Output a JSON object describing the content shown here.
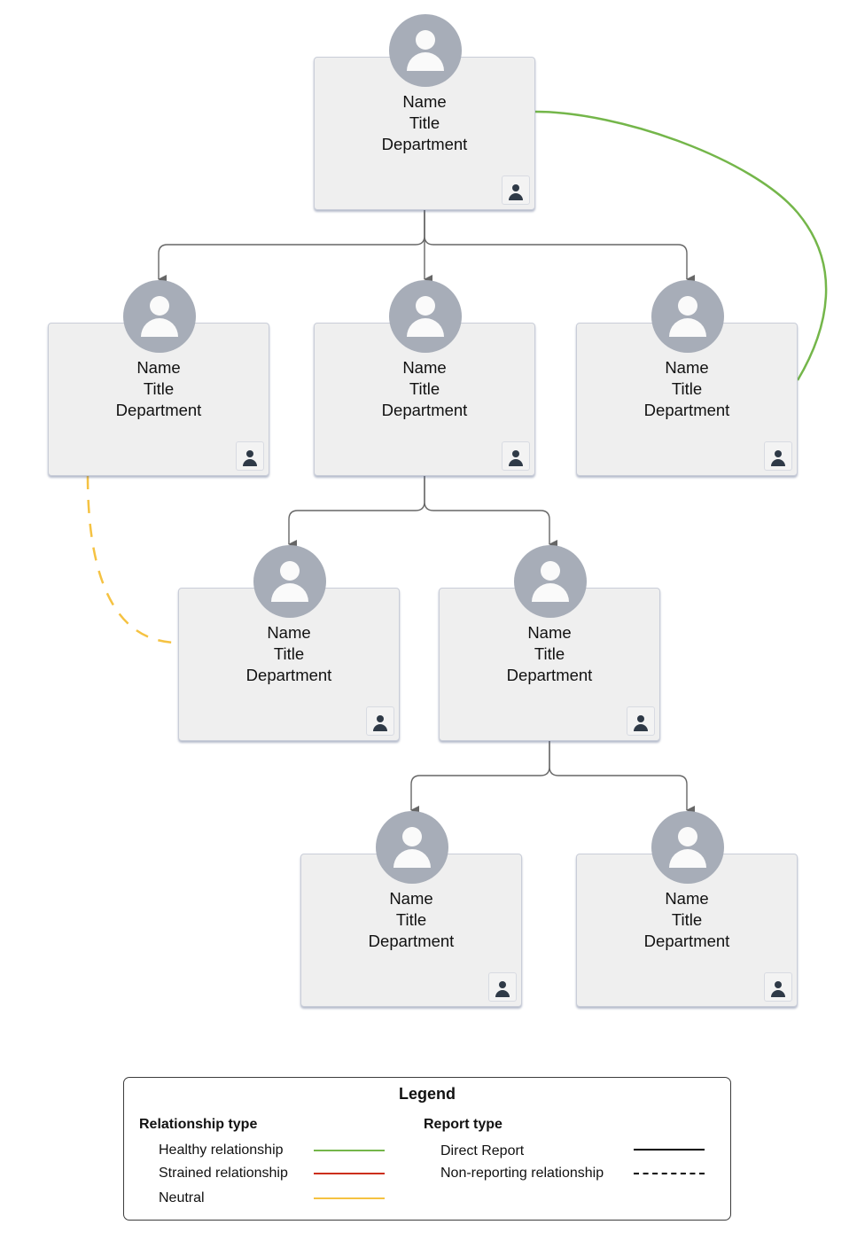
{
  "diagram": {
    "type": "org-chart",
    "nodes": [
      {
        "id": "n0",
        "name": "Name",
        "title": "Title",
        "department": "Department"
      },
      {
        "id": "n1",
        "name": "Name",
        "title": "Title",
        "department": "Department"
      },
      {
        "id": "n2",
        "name": "Name",
        "title": "Title",
        "department": "Department"
      },
      {
        "id": "n3",
        "name": "Name",
        "title": "Title",
        "department": "Department"
      },
      {
        "id": "n4",
        "name": "Name",
        "title": "Title",
        "department": "Department"
      },
      {
        "id": "n5",
        "name": "Name",
        "title": "Title",
        "department": "Department"
      },
      {
        "id": "n6",
        "name": "Name",
        "title": "Title",
        "department": "Department"
      },
      {
        "id": "n7",
        "name": "Name",
        "title": "Title",
        "department": "Department"
      }
    ],
    "edges": [
      {
        "from": "n0",
        "to": "n1",
        "report": "direct"
      },
      {
        "from": "n0",
        "to": "n2",
        "report": "direct"
      },
      {
        "from": "n0",
        "to": "n3",
        "report": "direct"
      },
      {
        "from": "n2",
        "to": "n4",
        "report": "direct"
      },
      {
        "from": "n2",
        "to": "n5",
        "report": "direct"
      },
      {
        "from": "n5",
        "to": "n6",
        "report": "direct"
      },
      {
        "from": "n5",
        "to": "n7",
        "report": "direct"
      },
      {
        "from": "n0",
        "to": "n3",
        "report": "non-reporting",
        "relationship": "healthy"
      },
      {
        "from": "n1",
        "to": "n4",
        "report": "non-reporting",
        "relationship": "neutral"
      }
    ]
  },
  "colors": {
    "direct_report": "#666666",
    "healthy": "#74b64a",
    "strained": "#cc2e13",
    "neutral": "#f5c242",
    "legend_direct": "#000000"
  },
  "legend": {
    "title": "Legend",
    "relationship_heading": "Relationship type",
    "relationship_items": [
      {
        "label": "Healthy relationship",
        "color": "#74b64a"
      },
      {
        "label": "Strained relationship",
        "color": "#cc2e13"
      },
      {
        "label": "Neutral",
        "color": "#f5c242"
      }
    ],
    "report_heading": "Report type",
    "report_items": [
      {
        "label": "Direct Report",
        "style": "solid"
      },
      {
        "label": "Non-reporting relationship",
        "style": "dashed"
      }
    ]
  }
}
